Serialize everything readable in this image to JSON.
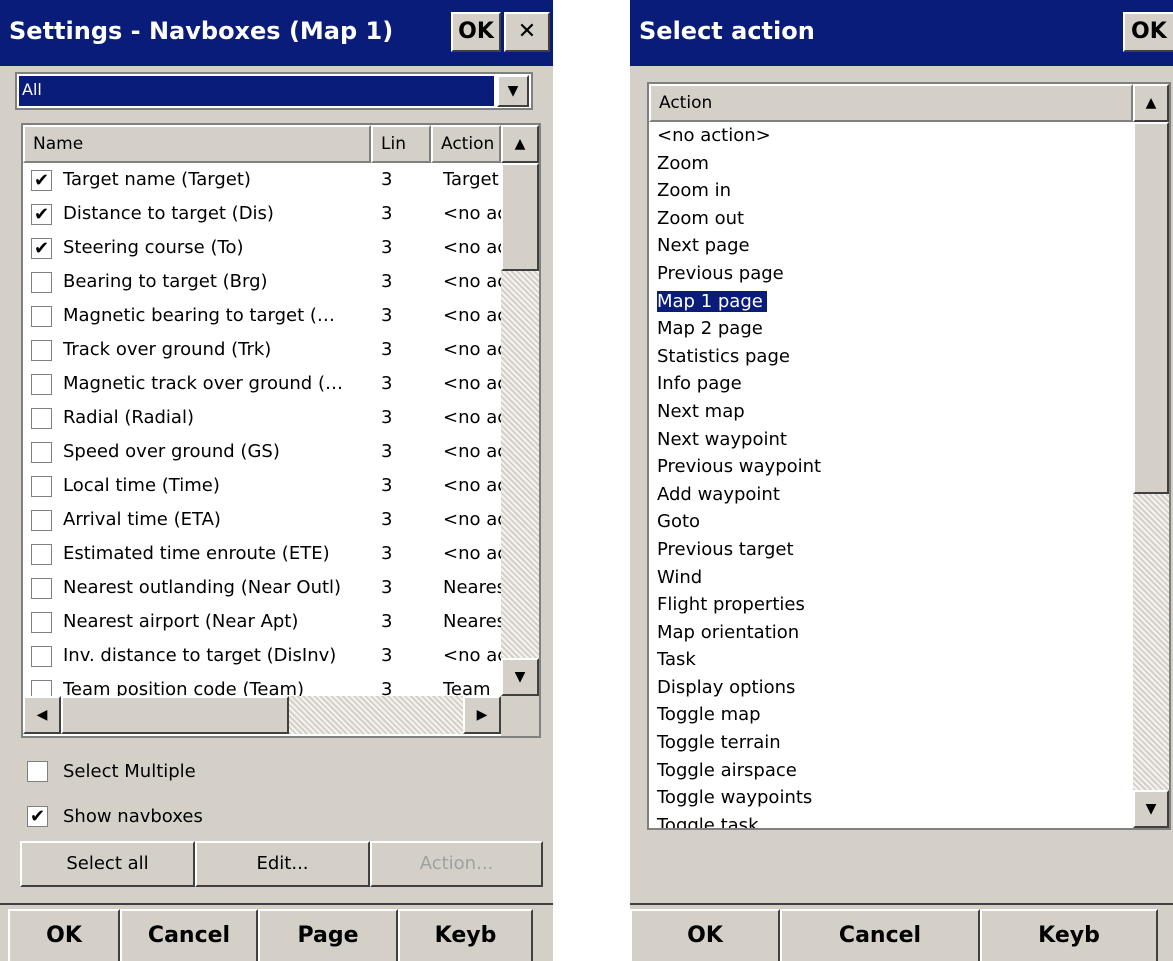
{
  "navboxes_dialog": {
    "title": "Settings - Navboxes (Map 1)",
    "ok_label": "OK",
    "close_label": "✕",
    "filter": {
      "value": "All"
    },
    "columns": [
      "Name",
      "Lin",
      "Action"
    ],
    "rows": [
      {
        "checked": true,
        "name": "Target name (Target)",
        "lin": "3",
        "action": "Target"
      },
      {
        "checked": true,
        "name": "Distance to target (Dis)",
        "lin": "3",
        "action": "<no action>"
      },
      {
        "checked": true,
        "name": "Steering course (To)",
        "lin": "3",
        "action": "<no action>"
      },
      {
        "checked": false,
        "name": "Bearing to target (Brg)",
        "lin": "3",
        "action": "<no action>"
      },
      {
        "checked": false,
        "name": "Magnetic bearing to target (…",
        "lin": "3",
        "action": "<no action>"
      },
      {
        "checked": false,
        "name": "Track over ground (Trk)",
        "lin": "3",
        "action": "<no action>"
      },
      {
        "checked": false,
        "name": "Magnetic track over ground (…",
        "lin": "3",
        "action": "<no action>"
      },
      {
        "checked": false,
        "name": "Radial (Radial)",
        "lin": "3",
        "action": "<no action>"
      },
      {
        "checked": false,
        "name": "Speed over ground (GS)",
        "lin": "3",
        "action": "<no action>"
      },
      {
        "checked": false,
        "name": "Local time (Time)",
        "lin": "3",
        "action": "<no action>"
      },
      {
        "checked": false,
        "name": "Arrival time (ETA)",
        "lin": "3",
        "action": "<no action>"
      },
      {
        "checked": false,
        "name": "Estimated time enroute (ETE)",
        "lin": "3",
        "action": "<no action>"
      },
      {
        "checked": false,
        "name": "Nearest outlanding (Near Outl)",
        "lin": "3",
        "action": "Nearest"
      },
      {
        "checked": false,
        "name": "Nearest airport (Near Apt)",
        "lin": "3",
        "action": "Nearest"
      },
      {
        "checked": false,
        "name": "Inv. distance to target (DisInv)",
        "lin": "3",
        "action": "<no action>"
      },
      {
        "checked": false,
        "name": "Team position code (Team)",
        "lin": "3",
        "action": "Team"
      }
    ],
    "select_multiple": {
      "label": "Select Multiple",
      "checked": false
    },
    "show_navboxes": {
      "label": "Show navboxes",
      "checked": true
    },
    "buttons": {
      "select_all": "Select all",
      "edit": "Edit...",
      "action": "Action..."
    },
    "menu": {
      "ok": "OK",
      "cancel": "Cancel",
      "page": "Page",
      "keyb": "Keyb"
    }
  },
  "action_dialog": {
    "title": "Select action",
    "ok_label": "OK",
    "column": "Action",
    "selected": "Map 1 page",
    "items": [
      "<no action>",
      "Zoom",
      "Zoom in",
      "Zoom out",
      "Next page",
      "Previous page",
      "Map 1 page",
      "Map 2 page",
      "Statistics page",
      "Info page",
      "Next map",
      "Next waypoint",
      "Previous waypoint",
      "Add waypoint",
      "Goto",
      "Previous target",
      "Wind",
      "Flight properties",
      "Map orientation",
      "Task",
      "Display options",
      "Toggle map",
      "Toggle terrain",
      "Toggle airspace",
      "Toggle waypoints",
      "Toggle task"
    ],
    "menu": {
      "ok": "OK",
      "cancel": "Cancel",
      "keyb": "Keyb"
    }
  }
}
